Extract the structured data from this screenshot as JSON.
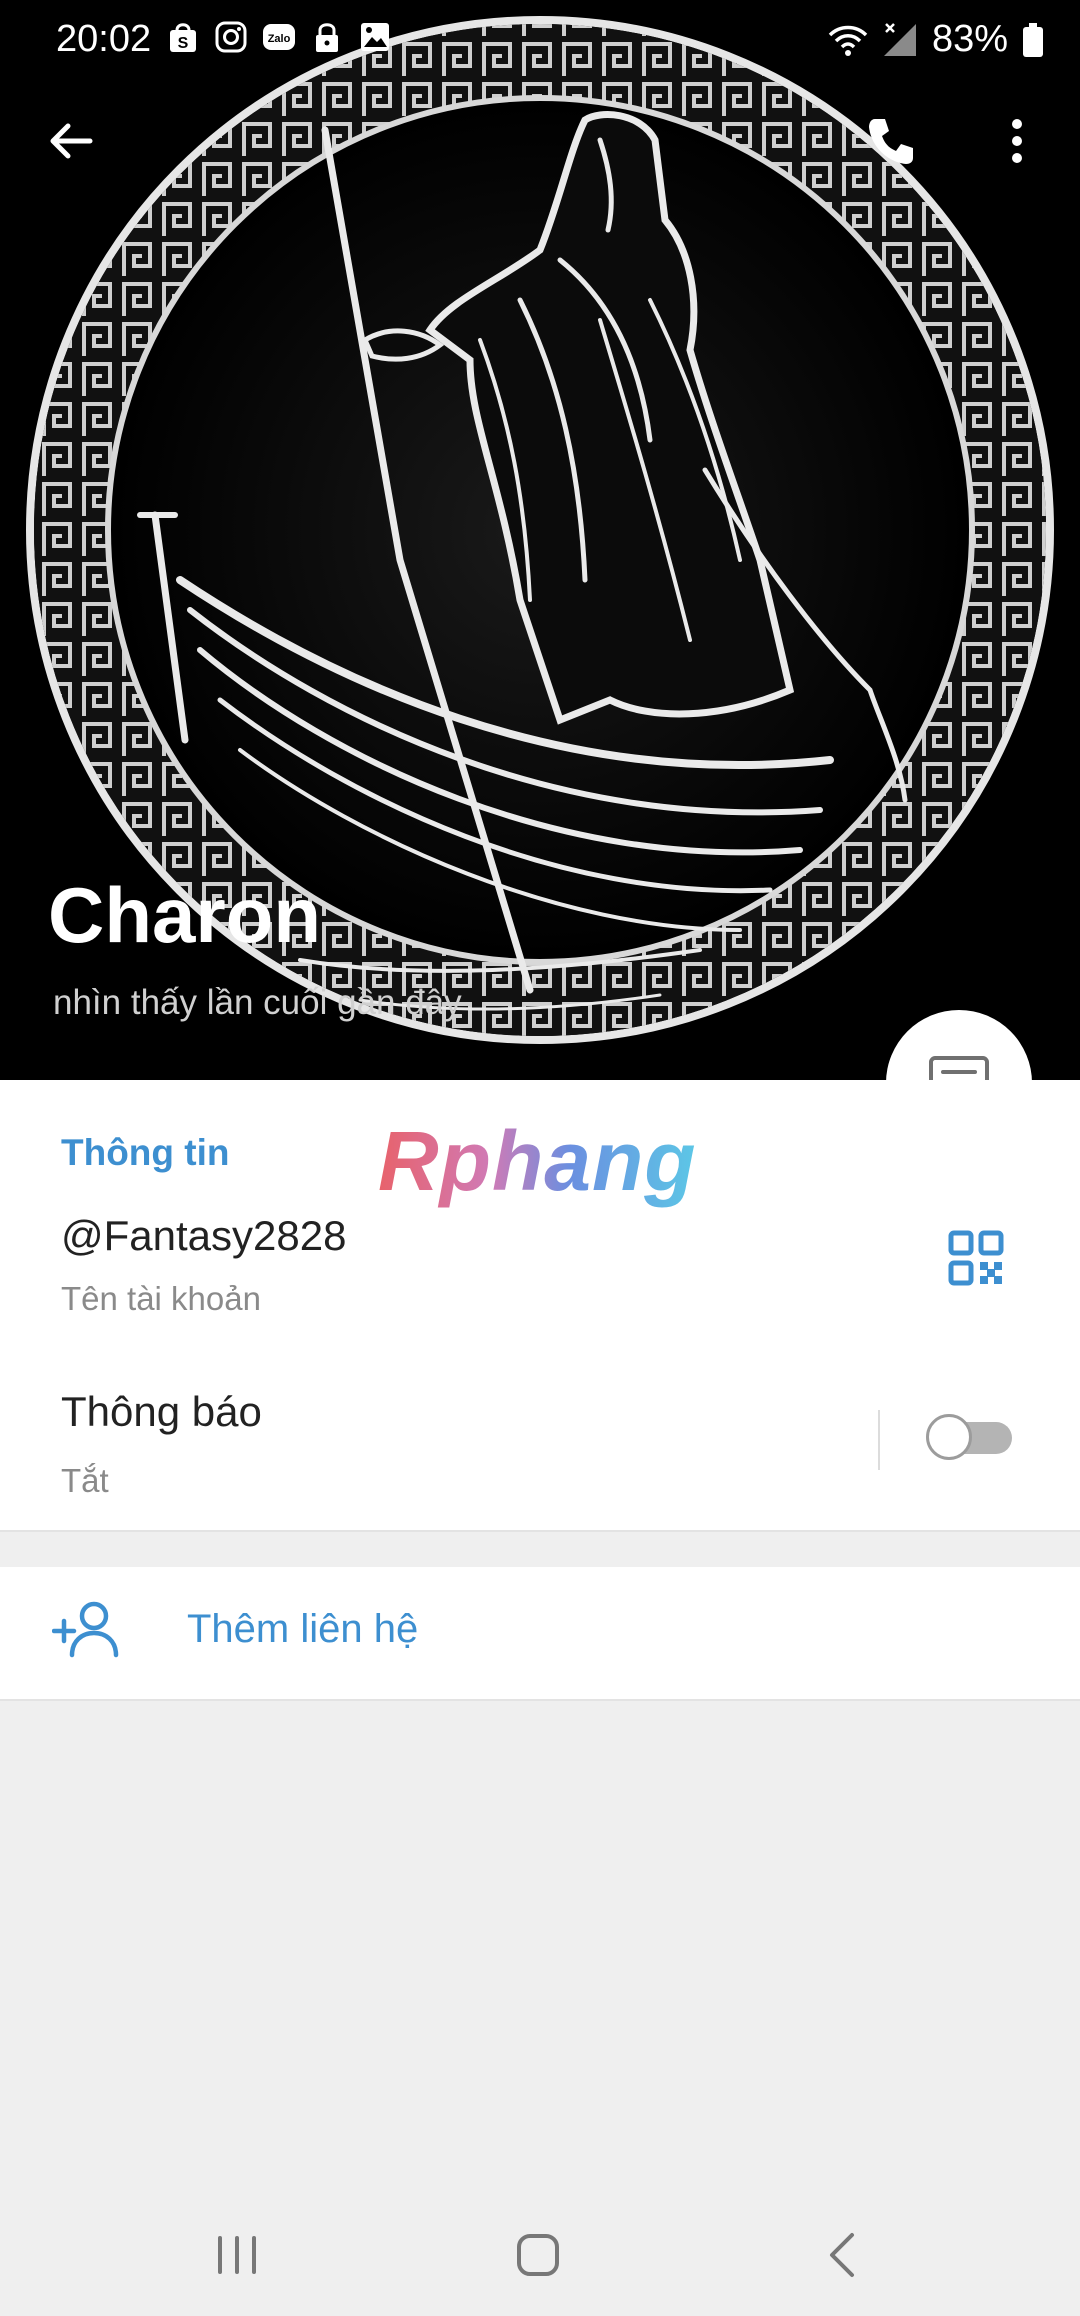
{
  "status_bar": {
    "time": "20:02",
    "battery": "83%",
    "icons_left": [
      "shopee-icon",
      "instagram-icon",
      "zalo-icon",
      "lock-icon",
      "gallery-icon"
    ],
    "zalo_text": "Zalo",
    "icons_right": [
      "wifi-icon",
      "signal-icon",
      "battery-icon"
    ]
  },
  "header": {
    "name": "Charon",
    "last_seen": "nhìn thấy lần cuối gần đây"
  },
  "info": {
    "section_title": "Thông tin",
    "watermark": "Rphang",
    "username": "@Fantasy2828",
    "username_label": "Tên tài khoản",
    "notifications_title": "Thông báo",
    "notifications_value": "Tắt",
    "notifications_enabled": false
  },
  "actions": {
    "add_contact": "Thêm liên hệ"
  },
  "colors": {
    "accent": "#3d8fd0",
    "background": "#efefef",
    "card": "#ffffff"
  }
}
